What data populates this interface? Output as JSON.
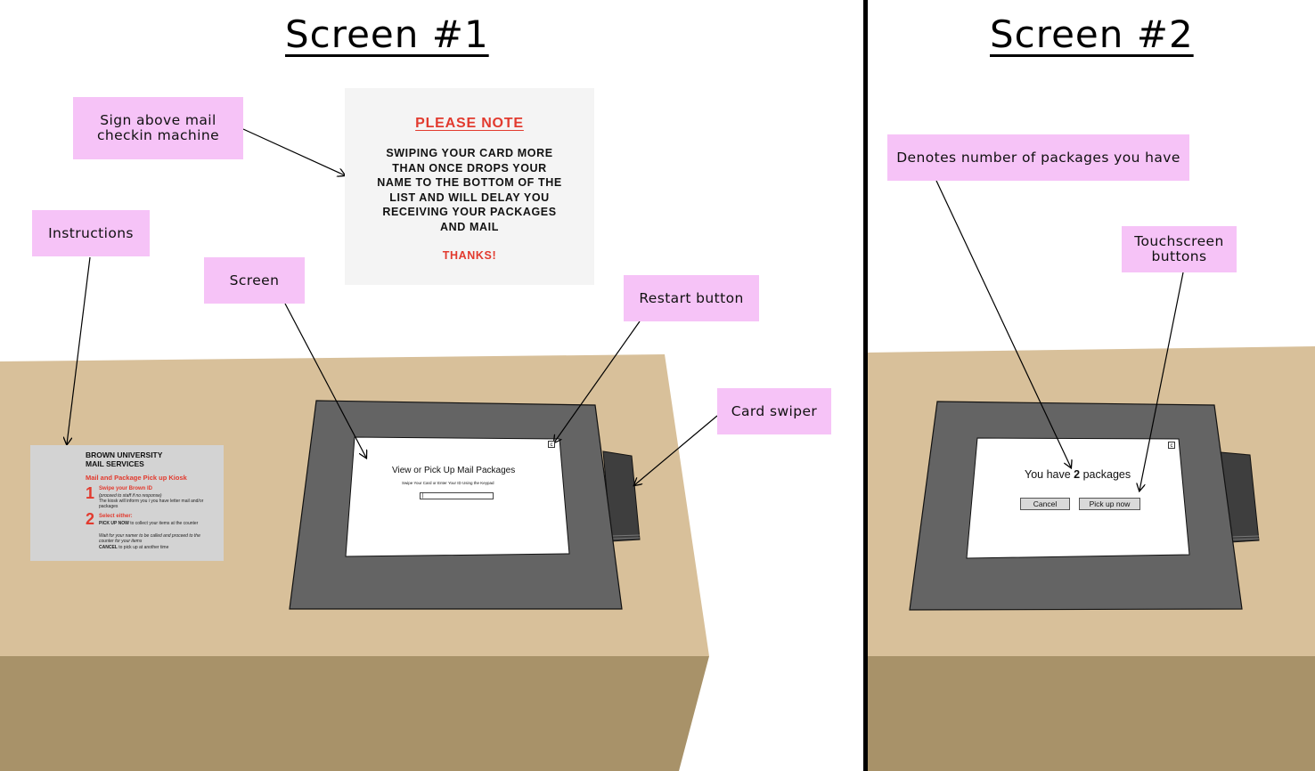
{
  "screen1": {
    "heading": "Screen #1",
    "annotations": {
      "sign_label": "Sign above mail checkin machine",
      "instructions_label": "Instructions",
      "screen_label": "Screen",
      "restart_label": "Restart button",
      "card_swiper_label": "Card swiper"
    },
    "sign": {
      "title": "PLEASE NOTE",
      "body": "SWIPING YOUR CARD MORE THAN ONCE DROPS YOUR NAME TO THE BOTTOM OF THE LIST AND WILL DELAY YOU RECEIVING YOUR PACKAGES AND MAIL",
      "thanks": "THANKS!"
    },
    "instruction_card": {
      "org": "BROWN UNIVERSITY MAIL SERVICES",
      "kiosk_title": "Mail and Package Pick up Kiosk",
      "step1_number": "1",
      "step1_title": "Swipe your Brown ID",
      "step1_note": "(proceed to staff if no response)",
      "step1_text": "The kiosk will inform you i you have letter mail and/or packages",
      "step2_number": "2",
      "step2_title": "Select either:",
      "step2_option1_bold": "PICK UP NOW",
      "step2_option1_text": "to collect your items at the counter",
      "step2_option1_note": "Wait for your namer to be called and proceed to the counter for your items",
      "step2_option2_bold": "CANCEL",
      "step2_option2_text": "to pick up at another time"
    },
    "kiosk_screen": {
      "title": "View or Pick Up Mail Packages",
      "subtitle": "Swipe Your Card or Enter Your ID Using the Keypad",
      "input_value": "|",
      "restart_icon": "c"
    }
  },
  "screen2": {
    "heading": "Screen #2",
    "annotations": {
      "packages_label": "Denotes number of packages you have",
      "buttons_label": "Touchscreen buttons"
    },
    "kiosk_screen": {
      "message_prefix": "You have",
      "package_count": "2",
      "message_suffix": "packages",
      "cancel_button": "Cancel",
      "pickup_button": "Pick up now",
      "restart_icon": "c"
    }
  },
  "colors": {
    "sticky_note": "#f6c3f7",
    "table_top": "#d8c09a",
    "table_front": "#a89269",
    "kiosk_frame": "#646464",
    "accent_red": "#e23a2e"
  }
}
